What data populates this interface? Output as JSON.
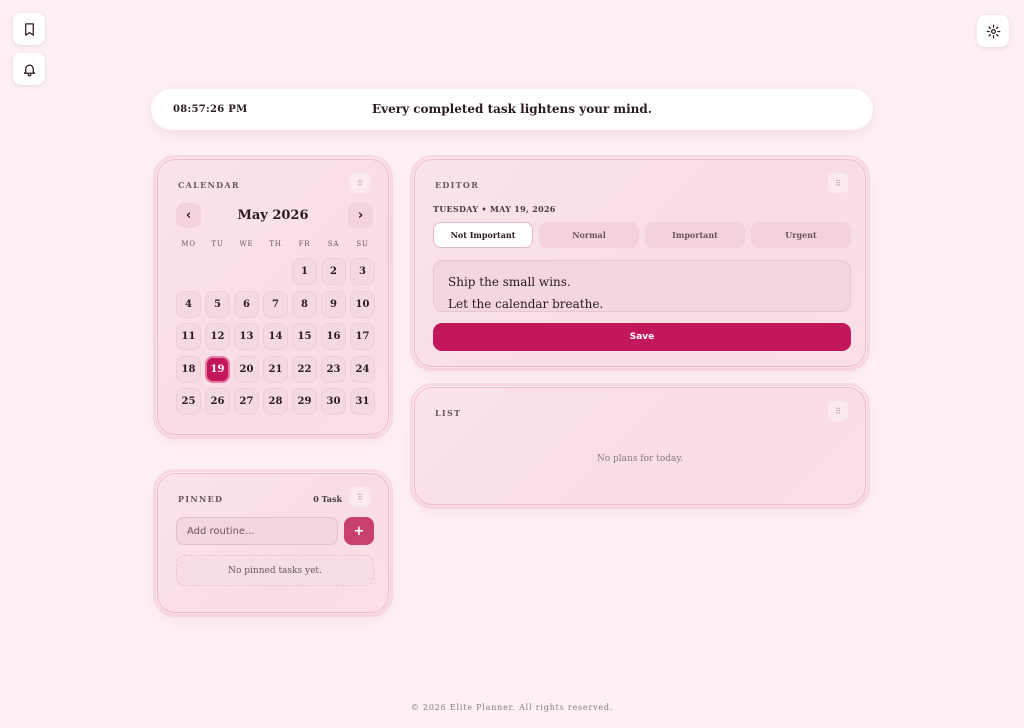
{
  "topbar": {
    "clock": "08:57:26 PM",
    "quote": "Every completed task lightens your mind."
  },
  "icons": {
    "bookmark": "bookmark-icon",
    "bell": "bell-icon",
    "settings": "gear-icon",
    "grip": "drag-handle-icon"
  },
  "calendar": {
    "title": "CALENDAR",
    "month": "May 2026",
    "prev": "‹",
    "next": "›",
    "weekdays": [
      "MO",
      "TU",
      "WE",
      "TH",
      "FR",
      "SA",
      "SU"
    ],
    "days": [
      "1",
      "2",
      "3",
      "4",
      "5",
      "6",
      "7",
      "8",
      "9",
      "10",
      "11",
      "12",
      "13",
      "14",
      "15",
      "16",
      "17",
      "18",
      "19",
      "20",
      "21",
      "22",
      "23",
      "24",
      "25",
      "26",
      "27",
      "28",
      "29",
      "30",
      "31"
    ],
    "first_weekday_index": 4,
    "today": "19"
  },
  "editor": {
    "title": "EDITOR",
    "date": "TUESDAY • MAY 19, 2026",
    "priorities": [
      "Not Important",
      "Normal",
      "Important",
      "Urgent"
    ],
    "selected_priority": "Not Important",
    "text_lines": [
      "Ship the small wins.",
      "Let the calendar breathe."
    ],
    "save_label": "Save"
  },
  "list": {
    "title": "LIST",
    "empty": "No plans for today."
  },
  "pinned": {
    "title": "PINNED",
    "count": "0 Task",
    "input_placeholder": "Add routine...",
    "add_label": "+",
    "empty": "No pinned tasks yet."
  },
  "footer": "© 2026 Elite Planner. All rights reserved.",
  "colors": {
    "accent": "#c2185b",
    "background": "#fdf1f6",
    "card": "#fbe3ea"
  }
}
